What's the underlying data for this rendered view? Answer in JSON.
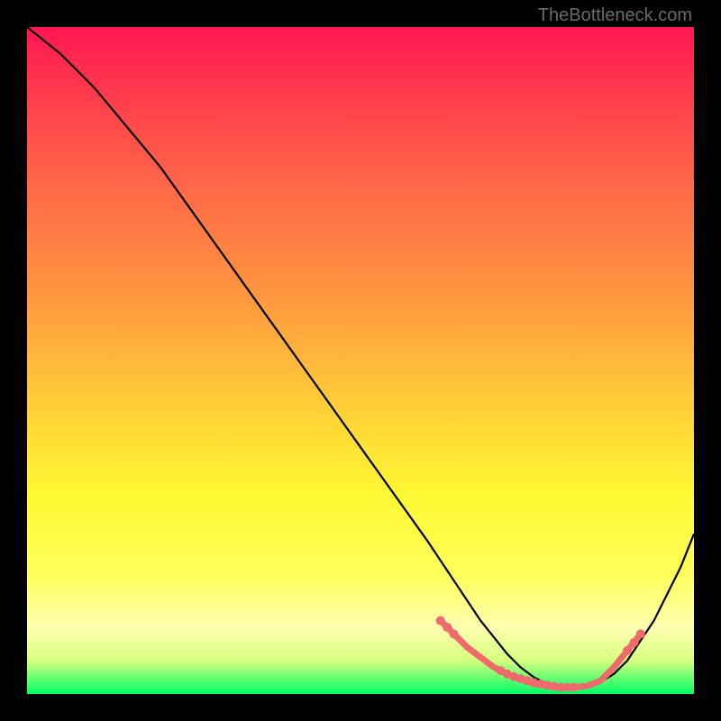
{
  "watermark": "TheBottleneck.com",
  "chart_data": {
    "type": "line",
    "title": "",
    "xlabel": "",
    "ylabel": "",
    "xlim": [
      0,
      100
    ],
    "ylim": [
      0,
      100
    ],
    "series": [
      {
        "name": "curve",
        "color": "#000000",
        "x": [
          0,
          5,
          10,
          15,
          20,
          25,
          30,
          35,
          40,
          45,
          50,
          55,
          60,
          62,
          64,
          66,
          68,
          70,
          72,
          74,
          76,
          78,
          80,
          82,
          84,
          86,
          88,
          90,
          92,
          94,
          96,
          98,
          100
        ],
        "y": [
          100,
          96,
          91,
          85,
          79,
          72,
          65,
          58,
          51,
          44,
          37,
          30,
          23,
          20,
          17,
          14,
          11,
          8.5,
          6,
          4,
          2.5,
          1.5,
          1,
          1,
          1.2,
          1.8,
          3,
          5,
          8,
          11,
          15,
          19,
          24
        ]
      },
      {
        "name": "highlight",
        "color": "#ef6a6a",
        "x": [
          62,
          64,
          66,
          68,
          70,
          72,
          74,
          76,
          78,
          80,
          82,
          84,
          86,
          88,
          90,
          92
        ],
        "y": [
          11,
          9,
          7,
          5.5,
          4,
          3,
          2.2,
          1.6,
          1.2,
          1,
          1,
          1.2,
          2,
          4,
          6.5,
          9
        ]
      }
    ],
    "highlight_dots": {
      "color": "#ef6a6a",
      "x": [
        62,
        63,
        64,
        71,
        72,
        73,
        74,
        75,
        76,
        77,
        78,
        79,
        80,
        81,
        82,
        90,
        91,
        92
      ],
      "y": [
        11,
        10,
        9,
        3.5,
        3,
        2.6,
        2.3,
        2,
        1.7,
        1.5,
        1.3,
        1.15,
        1,
        1,
        1,
        6.5,
        7.7,
        9
      ]
    }
  }
}
